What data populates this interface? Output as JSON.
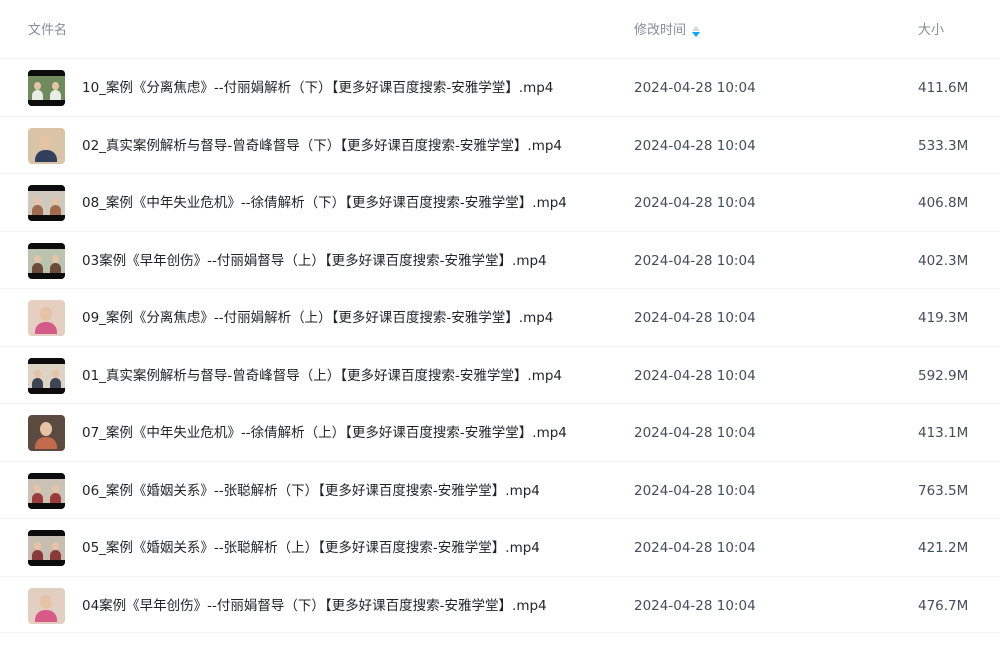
{
  "header": {
    "name_label": "文件名",
    "time_label": "修改时间",
    "size_label": "大小"
  },
  "sort": {
    "column": "修改时间",
    "active_color": "#06a7ff",
    "icon": "sort-icon"
  },
  "files": [
    {
      "name": "10_案例《分离焦虑》--付丽娟解析（下）【更多好课百度搜索-安雅学堂】.mp4",
      "time": "2024-04-28 10:04",
      "size": "411.6M",
      "thumb": {
        "style": "dual",
        "bg": "#6f8a5c",
        "accent": "#e9ece4"
      }
    },
    {
      "name": "02_真实案例解析与督导-曾奇峰督导（下）【更多好课百度搜索-安雅学堂】.mp4",
      "time": "2024-04-28 10:04",
      "size": "533.3M",
      "thumb": {
        "style": "face",
        "bg": "#d9c4a8",
        "accent": "#2f3f5c"
      }
    },
    {
      "name": "08_案例《中年失业危机》--徐倩解析（下）【更多好课百度搜索-安雅学堂】.mp4",
      "time": "2024-04-28 10:04",
      "size": "406.8M",
      "thumb": {
        "style": "dual",
        "bg": "#cfc8bc",
        "accent": "#a36b4d"
      }
    },
    {
      "name": "03案例《早年创伤》--付丽娟督导（上）【更多好课百度搜索-安雅学堂】.mp4",
      "time": "2024-04-28 10:04",
      "size": "402.3M",
      "thumb": {
        "style": "dual",
        "bg": "#b9c3b0",
        "accent": "#6c4a3a"
      }
    },
    {
      "name": "09_案例《分离焦虑》--付丽娟解析（上）【更多好课百度搜索-安雅学堂】.mp4",
      "time": "2024-04-28 10:04",
      "size": "419.3M",
      "thumb": {
        "style": "face",
        "bg": "#e4cfc1",
        "accent": "#d45a8a"
      }
    },
    {
      "name": "01_真实案例解析与督导-曾奇峰督导（上）【更多好课百度搜索-安雅学堂】.mp4",
      "time": "2024-04-28 10:04",
      "size": "592.9M",
      "thumb": {
        "style": "dual",
        "bg": "#ddd3c4",
        "accent": "#3c4657"
      }
    },
    {
      "name": "07_案例《中年失业危机》--徐倩解析（上）【更多好课百度搜索-安雅学堂】.mp4",
      "time": "2024-04-28 10:04",
      "size": "413.1M",
      "thumb": {
        "style": "face",
        "bg": "#5a4a40",
        "accent": "#c26a4c"
      }
    },
    {
      "name": "06_案例《婚姻关系》--张聪解析（下）【更多好课百度搜索-安雅学堂】.mp4",
      "time": "2024-04-28 10:04",
      "size": "763.5M",
      "thumb": {
        "style": "dual",
        "bg": "#cbc2b6",
        "accent": "#9c3b3b"
      }
    },
    {
      "name": "05_案例《婚姻关系》--张聪解析（上）【更多好课百度搜索-安雅学堂】.mp4",
      "time": "2024-04-28 10:04",
      "size": "421.2M",
      "thumb": {
        "style": "dual",
        "bg": "#c7beb2",
        "accent": "#8a3a3a"
      }
    },
    {
      "name": "04案例《早年创伤》--付丽娟督导（下）【更多好课百度搜索-安雅学堂】.mp4",
      "time": "2024-04-28 10:04",
      "size": "476.7M",
      "thumb": {
        "style": "face",
        "bg": "#e2cfc2",
        "accent": "#d75a88"
      }
    }
  ]
}
